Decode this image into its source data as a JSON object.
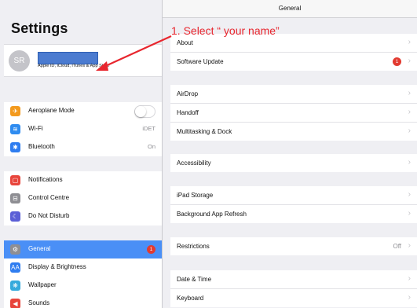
{
  "sidebar": {
    "title": "Settings",
    "profile": {
      "initials": "SR",
      "subtitle": "Apple ID, iCloud, iTunes & App Store"
    },
    "group1": [
      {
        "label": "Aeroplane Mode",
        "icon": "airplane-icon",
        "color": "#f39a1e",
        "glyph": "✈"
      },
      {
        "label": "Wi-Fi",
        "icon": "wifi-icon",
        "color": "#2f8cf0",
        "glyph": "≋",
        "value": "iDET"
      },
      {
        "label": "Bluetooth",
        "icon": "bluetooth-icon",
        "color": "#2f7df0",
        "glyph": "✱",
        "value": "On"
      }
    ],
    "group2": [
      {
        "label": "Notifications",
        "icon": "notifications-icon",
        "color": "#e8453c",
        "glyph": "▢"
      },
      {
        "label": "Control Centre",
        "icon": "control-centre-icon",
        "color": "#8e8e93",
        "glyph": "⊟"
      },
      {
        "label": "Do Not Disturb",
        "icon": "moon-icon",
        "color": "#5b5fd6",
        "glyph": "☾"
      }
    ],
    "group3": [
      {
        "label": "General",
        "icon": "gear-icon",
        "color": "#8e8e93",
        "glyph": "⚙",
        "badge": "1"
      },
      {
        "label": "Display & Brightness",
        "icon": "display-icon",
        "color": "#2f7df0",
        "glyph": "AA"
      },
      {
        "label": "Wallpaper",
        "icon": "wallpaper-icon",
        "color": "#35aadc",
        "glyph": "❋"
      },
      {
        "label": "Sounds",
        "icon": "sounds-icon",
        "color": "#e8453c",
        "glyph": "◀"
      }
    ]
  },
  "main": {
    "title": "General",
    "groups": [
      [
        {
          "label": "About"
        },
        {
          "label": "Software Update",
          "badge": "1"
        }
      ],
      [
        {
          "label": "AirDrop"
        },
        {
          "label": "Handoff"
        },
        {
          "label": "Multitasking & Dock"
        }
      ],
      [
        {
          "label": "Accessibility"
        }
      ],
      [
        {
          "label": "iPad Storage"
        },
        {
          "label": "Background App Refresh"
        }
      ],
      [
        {
          "label": "Restrictions",
          "value": "Off"
        }
      ],
      [
        {
          "label": "Date & Time"
        },
        {
          "label": "Keyboard"
        }
      ]
    ]
  },
  "annotation": {
    "text": "1. Select “ your name”",
    "color": "#e8262e"
  }
}
